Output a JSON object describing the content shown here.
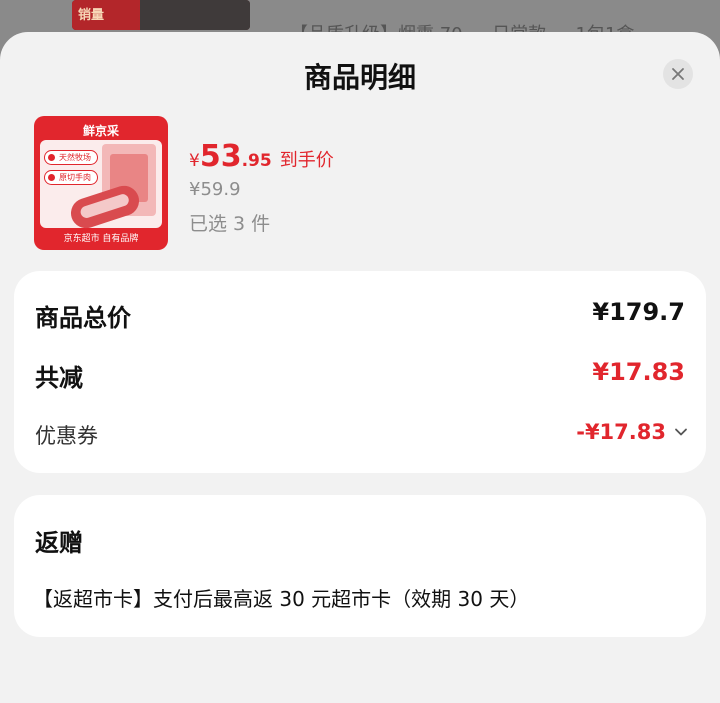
{
  "background": {
    "thumb_text": "销量",
    "title_fragment": "【品质升级】烟熏 70 — 日常款 — 1包1盒"
  },
  "sheet": {
    "title": "商品明细",
    "close_icon": "close-icon"
  },
  "product": {
    "thumb": {
      "brand": "鲜京采",
      "tag1": "天然牧场",
      "tag2": "原切手肉",
      "footer": "京东超市 自有品牌"
    },
    "price_symbol": "¥",
    "price_integer": "53",
    "price_decimal": ".95",
    "price_label": "到手价",
    "original_price": "¥59.9",
    "selected_count": "已选 3 件"
  },
  "summary": {
    "total_label": "商品总价",
    "total_value": "¥179.7",
    "reduction_label": "共减",
    "reduction_value": "¥17.83",
    "coupon_label": "优惠券",
    "coupon_value": "-¥17.83",
    "coupon_icon": "chevron-down-icon"
  },
  "rebate": {
    "title": "返赠",
    "text": "【返超市卡】支付后最高返 30 元超市卡（效期 30 天）"
  },
  "colors": {
    "accent": "#e1262d",
    "muted": "#8d8d8d",
    "sheet_bg": "#f2f2f2"
  }
}
